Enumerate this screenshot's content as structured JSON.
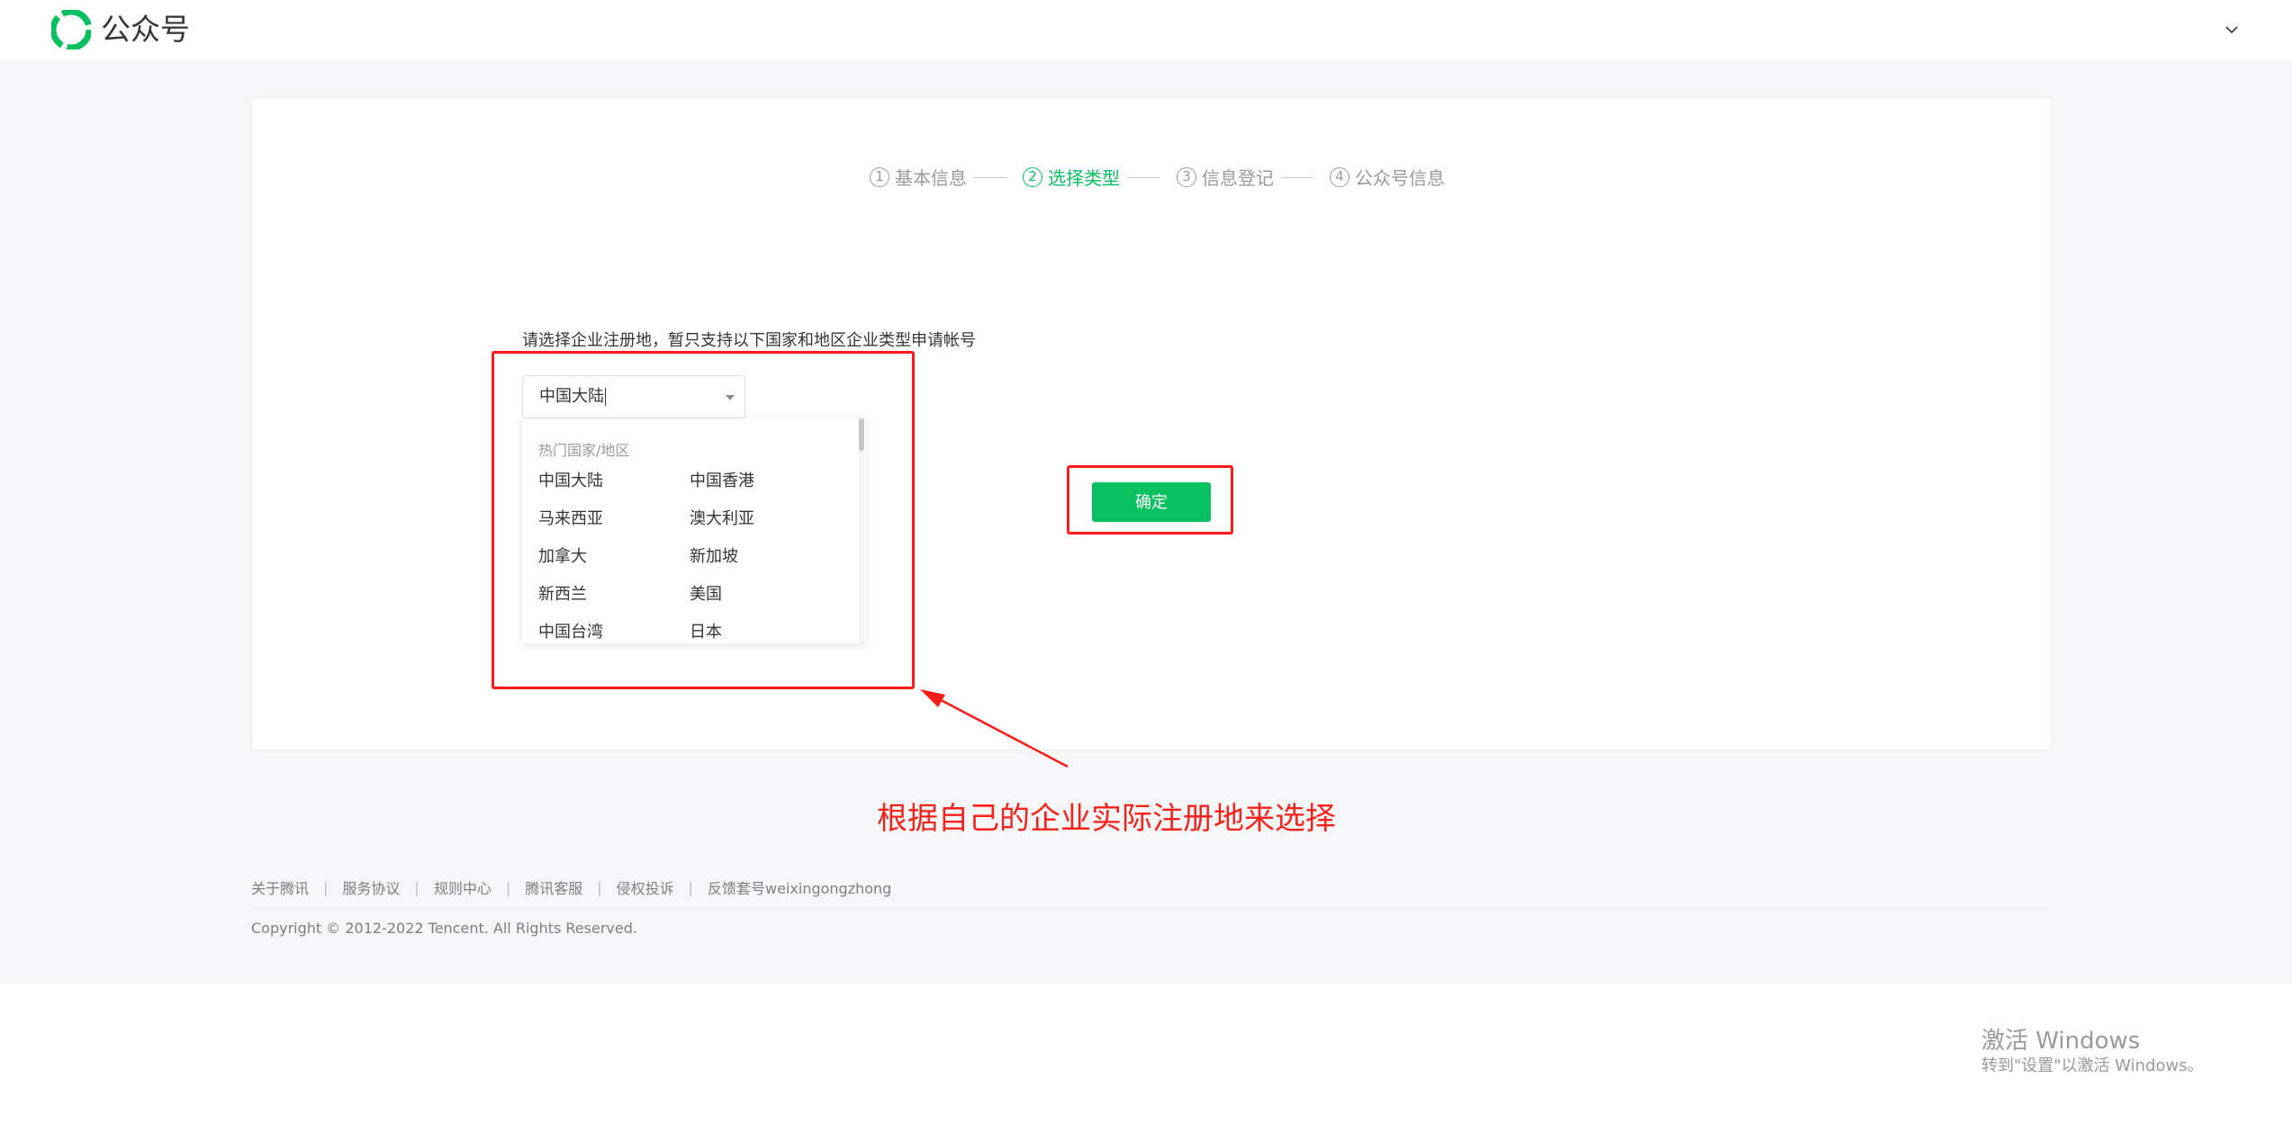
{
  "header": {
    "logo_text": "公众号",
    "brand_color": "#07c160",
    "icons": {
      "logo": "wechat-official-account-logo",
      "account_menu": "chevron-down-icon"
    }
  },
  "steps": [
    {
      "num": "1",
      "label": "基本信息",
      "active": false
    },
    {
      "num": "2",
      "label": "选择类型",
      "active": true
    },
    {
      "num": "3",
      "label": "信息登记",
      "active": false
    },
    {
      "num": "4",
      "label": "公众号信息",
      "active": false
    }
  ],
  "region": {
    "prompt": "请选择企业注册地，暂只支持以下国家和地区企业类型申请帐号",
    "selected": "中国大陆",
    "dropdown": {
      "group_title": "热门国家/地区",
      "options": [
        "中国大陆",
        "中国香港",
        "马来西亚",
        "澳大利亚",
        "加拿大",
        "新加坡",
        "新西兰",
        "美国",
        "中国台湾",
        "日本"
      ]
    }
  },
  "confirm_label": "确定",
  "annotation": {
    "text": "根据自己的企业实际注册地来选择",
    "color": "#f5231b"
  },
  "footer": {
    "links": [
      "关于腾讯",
      "服务协议",
      "规则中心",
      "腾讯客服",
      "侵权投诉",
      "反馈套号weixingongzhong"
    ],
    "separator": "|",
    "copyright": "Copyright © 2012-2022 Tencent. All Rights Reserved."
  },
  "windows_watermark": {
    "title": "激活 Windows",
    "subtitle": "转到\"设置\"以激活 Windows。"
  }
}
